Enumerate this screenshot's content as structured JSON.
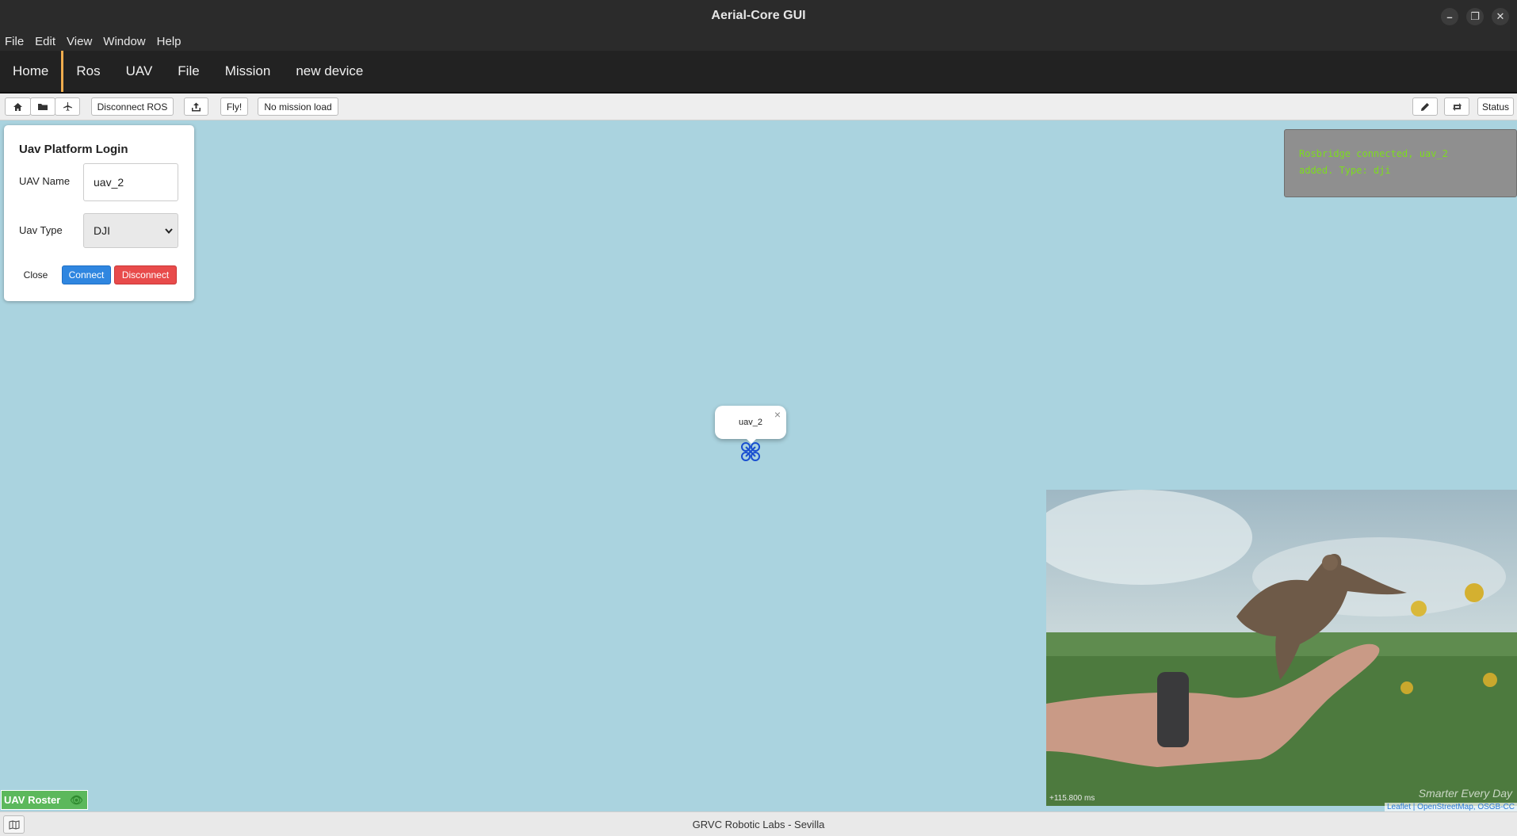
{
  "window": {
    "title": "Aerial-Core GUI"
  },
  "menu": {
    "items": [
      "File",
      "Edit",
      "View",
      "Window",
      "Help"
    ]
  },
  "nav": {
    "tabs": [
      "Home",
      "Ros",
      "UAV",
      "File",
      "Mission",
      "new device"
    ],
    "active": "Home"
  },
  "toolbar": {
    "icons_left": [
      "home-icon",
      "folder-icon",
      "plane-icon"
    ],
    "disconnect_ros": "Disconnect ROS",
    "upload_icon": "upload-icon",
    "fly": "Fly!",
    "mission": "No mission load",
    "icons_right": [
      "pencil-icon",
      "refresh-icon"
    ],
    "status": "Status"
  },
  "login": {
    "title": "Uav Platform Login",
    "name_label": "UAV Name",
    "name_value": "uav_2",
    "type_label": "Uav Type",
    "type_value": "DJI",
    "close": "Close",
    "connect": "Connect",
    "disconnect": "Disconnect"
  },
  "notification": {
    "line1": "Rosbridge connected, uav_2",
    "line2": "added. Type: dji"
  },
  "map": {
    "marker_label": "uav_2",
    "attribution": "Leaflet | OpenStreetMap, OSGB-CC"
  },
  "video": {
    "timestamp": "+115.800 ms",
    "watermark": "Smarter Every Day"
  },
  "roster": {
    "label": "UAV Roster"
  },
  "statusbar": {
    "text": "GRVC Robotic Labs - Sevilla"
  },
  "colors": {
    "map_water": "#aad3df",
    "connect": "#2f86e0",
    "disconnect": "#e84b4b",
    "roster": "#5cb85c",
    "notify_text": "#7ddc1f",
    "nav_active": "#f0ad4e"
  }
}
